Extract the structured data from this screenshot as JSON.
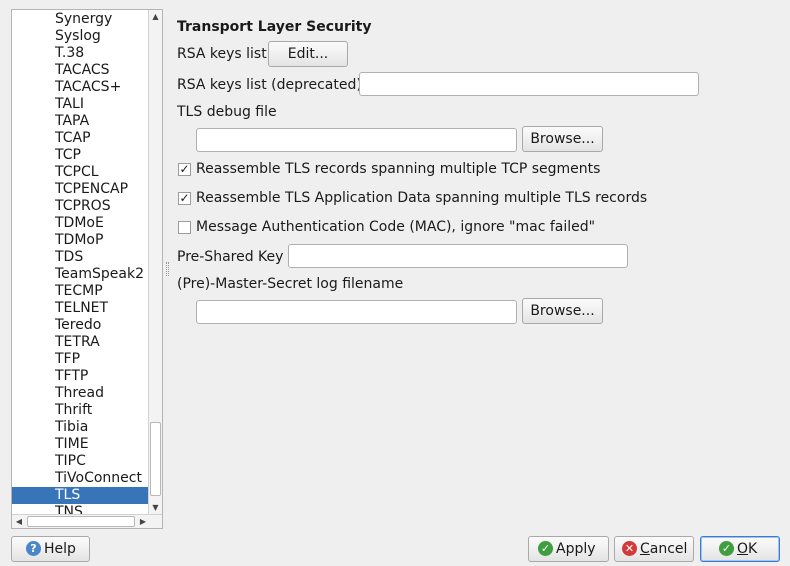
{
  "tree": {
    "items": [
      "Synergy",
      "Syslog",
      "T.38",
      "TACACS",
      "TACACS+",
      "TALI",
      "TAPA",
      "TCAP",
      "TCP",
      "TCPCL",
      "TCPENCAP",
      "TCPROS",
      "TDMoE",
      "TDMoP",
      "TDS",
      "TeamSpeak2",
      "TECMP",
      "TELNET",
      "Teredo",
      "TETRA",
      "TFP",
      "TFTP",
      "Thread",
      "Thrift",
      "Tibia",
      "TIME",
      "TIPC",
      "TiVoConnect",
      "TLS",
      "TNS"
    ],
    "selected": "TLS"
  },
  "panel": {
    "title": "Transport Layer Security",
    "rsa_keys_label": "RSA keys list",
    "rsa_edit_button": "Edit...",
    "rsa_deprecated_label": "RSA keys list (deprecated)",
    "rsa_deprecated_value": "",
    "tls_debug_label": "TLS debug file",
    "tls_debug_value": "",
    "browse_label": "Browse...",
    "checkbox_reassemble_records": {
      "label": "Reassemble TLS records spanning multiple TCP segments",
      "checked": true
    },
    "checkbox_reassemble_appdata": {
      "label": "Reassemble TLS Application Data spanning multiple TLS records",
      "checked": true
    },
    "checkbox_mac_ignore": {
      "label": "Message Authentication Code (MAC), ignore \"mac failed\"",
      "checked": false
    },
    "psk_label": "Pre-Shared Key",
    "psk_value": "",
    "master_secret_label": "(Pre)-Master-Secret log filename",
    "master_secret_value": ""
  },
  "footer": {
    "help": "Help",
    "apply": "Apply",
    "cancel_prefix": "",
    "cancel_key": "C",
    "cancel_rest": "ancel",
    "ok_key": "O",
    "ok_rest": "K"
  },
  "icons": {
    "help": "help-icon",
    "apply": "check-icon",
    "cancel": "cancel-icon",
    "ok": "check-icon"
  }
}
